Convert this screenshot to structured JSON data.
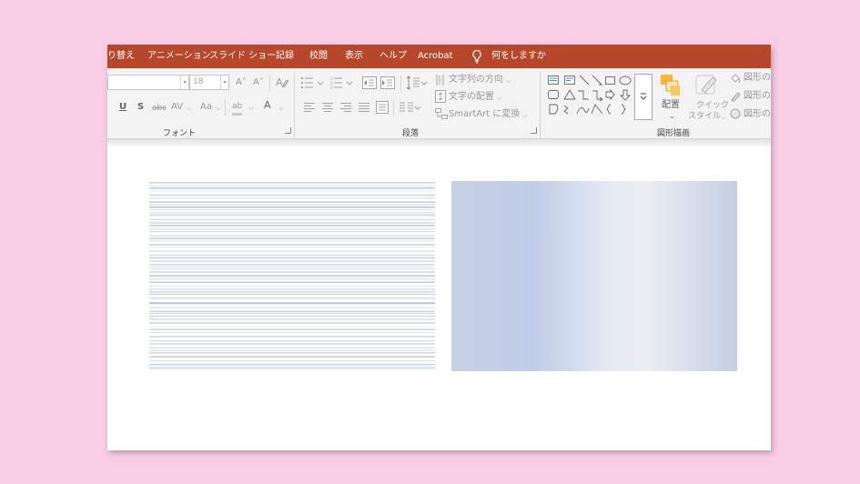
{
  "tabs": [
    "り替え",
    "アニメーション",
    "スライド ショー",
    "記録",
    "校閲",
    "表示",
    "ヘルプ",
    "Acrobat"
  ],
  "tell_me": "何をしますか",
  "font_group": {
    "label": "フォント",
    "size_value": "18",
    "grow_glyph": "A˄",
    "shrink_glyph": "A˅",
    "underline": "U",
    "strikethrough": "S",
    "shadow_abc": "abc",
    "spacing": "AV",
    "case": "Aa",
    "highlight": "ab",
    "font_color": "A"
  },
  "paragraph_group": {
    "label": "段落",
    "text_direction": "文字列の方向",
    "align_text": "文字の配置",
    "smartart": "SmartArt に変換"
  },
  "drawing_group": {
    "label": "図形描画",
    "arrange": "配置",
    "quick_styles_1": "クイック",
    "quick_styles_2": "スタイル",
    "shape_fill": "図形の",
    "shape_outline": "図形の",
    "shape_effects": "図形の"
  },
  "colors": {
    "tab_bar": "#b7472a",
    "background": "#f9cde4",
    "gradient": [
      "#c7d1e6",
      "#c0cde8",
      "#e9ecf4",
      "#ebedf2",
      "#c4cee3"
    ]
  }
}
